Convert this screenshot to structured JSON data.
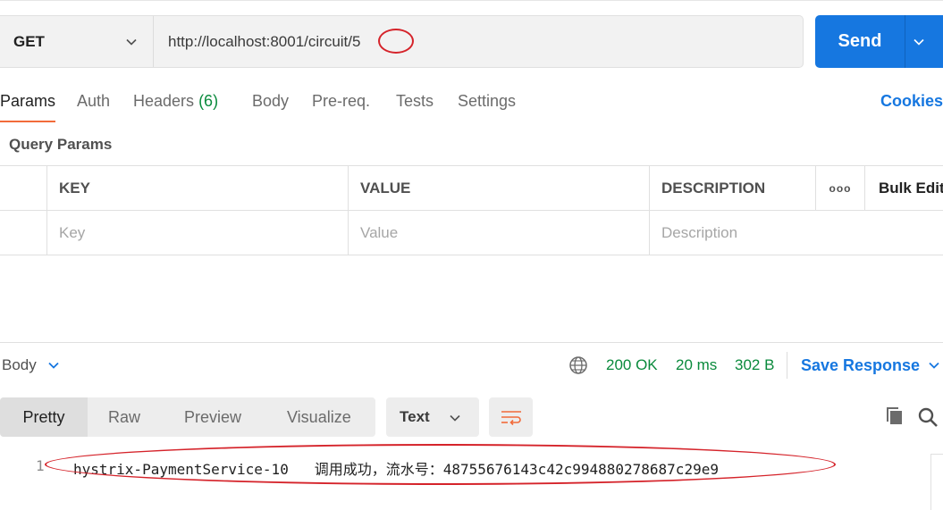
{
  "request": {
    "method": "GET",
    "url": "http://localhost:8001/circuit/5",
    "send_label": "Send"
  },
  "tabs": [
    {
      "label": "Params"
    },
    {
      "label": "Auth"
    },
    {
      "label": "Headers",
      "count": "(6)"
    },
    {
      "label": "Body"
    },
    {
      "label": "Pre-req."
    },
    {
      "label": "Tests"
    },
    {
      "label": "Settings"
    }
  ],
  "cookies_label": "Cookies",
  "query_params": {
    "title": "Query Params",
    "columns": [
      "KEY",
      "VALUE",
      "DESCRIPTION"
    ],
    "more_label": "ooo",
    "bulk_edit_label": "Bulk Edit",
    "placeholders": [
      "Key",
      "Value",
      "Description"
    ]
  },
  "response": {
    "body_label": "Body",
    "status": "200 OK",
    "time": "20 ms",
    "size": "302 B",
    "save_label": "Save Response",
    "views": [
      "Pretty",
      "Raw",
      "Preview",
      "Visualize"
    ],
    "format": "Text",
    "line_number": "1",
    "line_text": "hystrix-PaymentService-10   调用成功，流水号：48755676143c42c994880278687c29e9"
  },
  "colors": {
    "accent_blue": "#1677e0",
    "status_green": "#0a8a3c",
    "active_tab_orange": "#f26b3a",
    "annotation_red": "#d5232a"
  }
}
